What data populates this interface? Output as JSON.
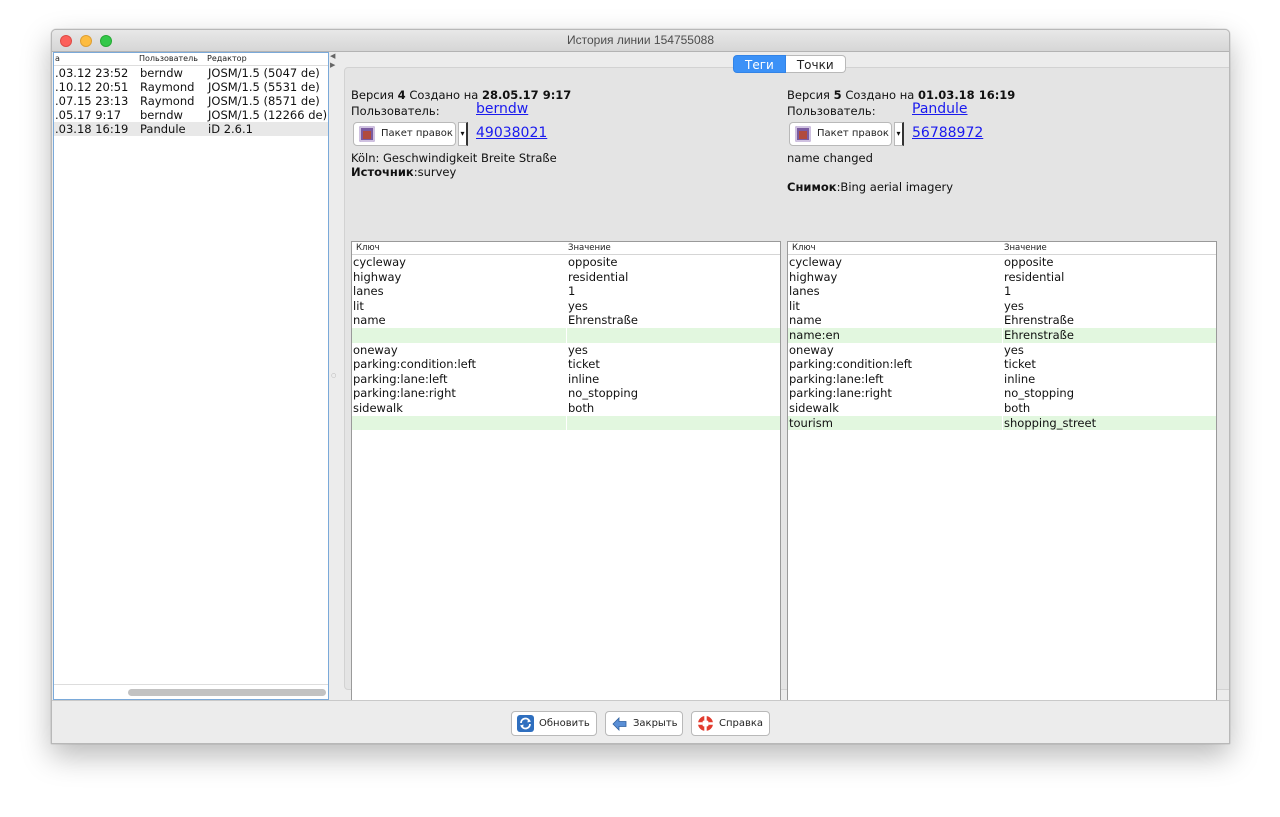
{
  "window": {
    "title": "История линии 154755088"
  },
  "history": {
    "columns": [
      "а",
      "Пользователь",
      "Редактор"
    ],
    "rows": [
      {
        "date": ".03.12 23:52",
        "user": "berndw",
        "editor": "JOSM/1.5 (5047 de)"
      },
      {
        "date": ".10.12 20:51",
        "user": "Raymond",
        "editor": "JOSM/1.5 (5531 de)"
      },
      {
        "date": ".07.15 23:13",
        "user": "Raymond",
        "editor": "JOSM/1.5 (8571 de)"
      },
      {
        "date": ".05.17 9:17",
        "user": "berndw",
        "editor": "JOSM/1.5 (12266 de)"
      },
      {
        "date": ".03.18 16:19",
        "user": "Pandule",
        "editor": "iD 2.6.1"
      }
    ]
  },
  "tabs": {
    "tags": "Теги",
    "nodes": "Точки"
  },
  "left": {
    "version_prefix": "Версия",
    "version_num": "4",
    "created_on": "Создано на",
    "datetime": "28.05.17 9:17",
    "user_label": "Пользователь:",
    "user": "berndw",
    "changeset_button": "Пакет правок",
    "changeset_id": "49038021",
    "comment": "Köln: Geschwindigkeit Breite Straße",
    "source_label": "Источник",
    "source_value": ":survey",
    "table_header": {
      "key": "Ключ",
      "value": "Значение"
    },
    "tags": [
      {
        "key": "cycleway",
        "value": "opposite"
      },
      {
        "key": "highway",
        "value": "residential"
      },
      {
        "key": "lanes",
        "value": "1"
      },
      {
        "key": "lit",
        "value": "yes"
      },
      {
        "key": "name",
        "value": "Ehrenstraße"
      },
      {
        "key": "",
        "value": "",
        "added": true
      },
      {
        "key": "oneway",
        "value": "yes"
      },
      {
        "key": "parking:condition:left",
        "value": "ticket"
      },
      {
        "key": "parking:lane:left",
        "value": "inline"
      },
      {
        "key": "parking:lane:right",
        "value": "no_stopping"
      },
      {
        "key": "sidewalk",
        "value": "both"
      },
      {
        "key": "",
        "value": "",
        "added": true
      }
    ]
  },
  "right": {
    "version_prefix": "Версия",
    "version_num": "5",
    "created_on": "Создано на",
    "datetime": "01.03.18 16:19",
    "user_label": "Пользователь:",
    "user": "Pandule",
    "changeset_button": "Пакет правок",
    "changeset_id": "56788972",
    "comment": "name changed",
    "source_label": "Снимок",
    "source_value": ":Bing aerial imagery",
    "table_header": {
      "key": "Ключ",
      "value": "Значение"
    },
    "tags": [
      {
        "key": "cycleway",
        "value": "opposite"
      },
      {
        "key": "highway",
        "value": "residential"
      },
      {
        "key": "lanes",
        "value": "1"
      },
      {
        "key": "lit",
        "value": "yes"
      },
      {
        "key": "name",
        "value": "Ehrenstraße"
      },
      {
        "key": "name:en",
        "value": "Ehrenstraße",
        "added": true
      },
      {
        "key": "oneway",
        "value": "yes"
      },
      {
        "key": "parking:condition:left",
        "value": "ticket"
      },
      {
        "key": "parking:lane:left",
        "value": "inline"
      },
      {
        "key": "parking:lane:right",
        "value": "no_stopping"
      },
      {
        "key": "sidewalk",
        "value": "both"
      },
      {
        "key": "tourism",
        "value": "shopping_street",
        "added": true
      }
    ]
  },
  "buttons": {
    "refresh": "Обновить",
    "close": "Закрыть",
    "help": "Справка"
  },
  "colors": {
    "added_row": "#e2f7df",
    "tab_active": "#3b91f7",
    "link": "#1a1aee"
  },
  "icons": {
    "refresh": "refresh-icon",
    "close": "close-icon",
    "help": "lifebuoy-icon",
    "changeset": "changeset-icon"
  }
}
